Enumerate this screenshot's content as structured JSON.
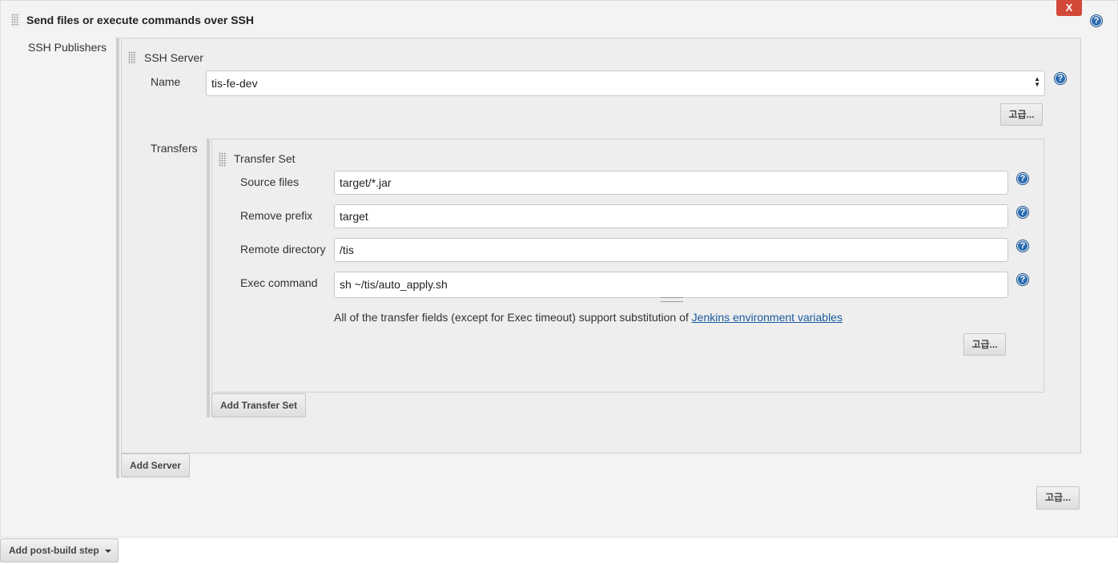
{
  "section": {
    "title": "Send files or execute commands over SSH",
    "close_label": "X",
    "publishers_label": "SSH Publishers"
  },
  "ssh_server": {
    "title": "SSH Server",
    "name_label": "Name",
    "name_value": "tis-fe-dev",
    "advanced_label": "고급..."
  },
  "transfers": {
    "label": "Transfers",
    "set_title": "Transfer Set",
    "source_files_label": "Source files",
    "source_files_value": "target/*.jar",
    "remove_prefix_label": "Remove prefix",
    "remove_prefix_value": "target",
    "remote_directory_label": "Remote directory",
    "remote_directory_value": "/tis",
    "exec_command_label": "Exec command",
    "exec_command_value": "sh ~/tis/auto_apply.sh",
    "note_text": "All of the transfer fields (except for Exec timeout) support substitution of ",
    "note_link": "Jenkins environment variables",
    "advanced_label": "고급...",
    "add_transfer_set_label": "Add Transfer Set"
  },
  "add_server_label": "Add Server",
  "section_advanced_label": "고급...",
  "add_post_build_step_label": "Add post-build step",
  "help_glyph": "?",
  "colors": {
    "close_button": "#d24939",
    "help_icon": "#2b6cb0",
    "link": "#1a5a9e"
  }
}
